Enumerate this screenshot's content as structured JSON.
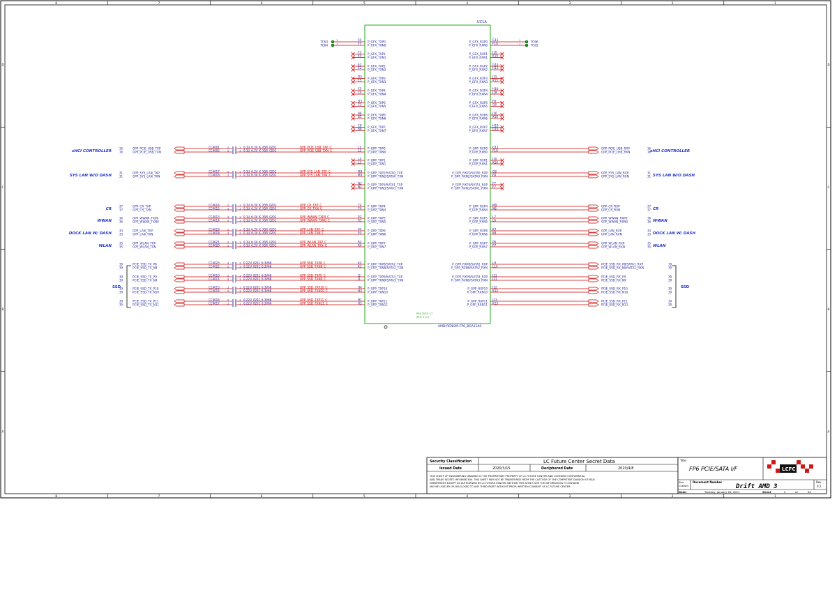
{
  "chip": {
    "ref": "UC1A",
    "part": "AMD-RENOIR-FP6_BGA1140",
    "stamp1": "PRE-TEST: 12",
    "stamp2": "REV: 1.1.0"
  },
  "test_points": {
    "left": [
      {
        "name": "TC63",
        "pin": "1"
      },
      {
        "name": "TC64",
        "pin": "1"
      }
    ],
    "right": [
      {
        "name": "TC66",
        "pin": "1"
      },
      {
        "name": "TC65",
        "pin": "1"
      }
    ]
  },
  "gfx_tx": [
    {
      "pins": [
        "F6",
        "F7"
      ],
      "nets": [
        "P_GFX_TXP0",
        "P_GFX_TXN0"
      ]
    },
    {
      "pins": [
        "F3",
        "E4"
      ],
      "nets": [
        "P_GFX_TXP1",
        "P_GFX_TXN1"
      ]
    },
    {
      "pins": [
        "E1",
        "E2"
      ],
      "nets": [
        "P_GFX_TXP2",
        "P_GFX_TXN2"
      ]
    },
    {
      "pins": [
        "D5",
        "E5"
      ],
      "nets": [
        "P_GFX_TXP3",
        "P_GFX_TXN3"
      ]
    },
    {
      "pins": [
        "C5",
        "C4"
      ],
      "nets": [
        "P_GFX_TXP4",
        "P_GFX_TXN4"
      ]
    },
    {
      "pins": [
        "D3",
        "C3"
      ],
      "nets": [
        "P_GFX_TXP5",
        "P_GFX_TXN5"
      ]
    },
    {
      "pins": [
        "B6",
        "B5"
      ],
      "nets": [
        "P_GFX_TXP6",
        "P_GFX_TXN6"
      ]
    },
    {
      "pins": [
        "C8",
        "B8"
      ],
      "nets": [
        "P_GFX_TXP7",
        "P_GFX_TXN7"
      ]
    }
  ],
  "gfx_rx": [
    {
      "pins": [
        "G11",
        "F10"
      ],
      "nets": [
        "P_GFX_RXP0",
        "P_GFX_RXN0"
      ]
    },
    {
      "pins": [
        "J10",
        "K10"
      ],
      "nets": [
        "P_GFX_RXP1",
        "P_GFX_RXN1"
      ]
    },
    {
      "pins": [
        "G13",
        "H13"
      ],
      "nets": [
        "P_GFX_RXP2",
        "P_GFX_RXN2"
      ]
    },
    {
      "pins": [
        "J15",
        "K15"
      ],
      "nets": [
        "P_GFX_RXP3",
        "P_GFX_RXN3"
      ]
    },
    {
      "pins": [
        "H18",
        "J18"
      ],
      "nets": [
        "P_GFX_RXP4",
        "P_GFX_RXN4"
      ]
    },
    {
      "pins": [
        "F8",
        "G8"
      ],
      "nets": [
        "P_GFX_RXP5",
        "P_GFX_RXN5"
      ]
    },
    {
      "pins": [
        "J16",
        "K16"
      ],
      "nets": [
        "P_GFX_RXP6",
        "P_GFX_RXN6"
      ]
    },
    {
      "pins": [
        "H19",
        "G19"
      ],
      "nets": [
        "P_GFX_RXP7",
        "P_GFX_RXN7"
      ]
    }
  ],
  "gpp_left": [
    {
      "label": "xHCI CONTROLLER",
      "sheet": "16",
      "caps": [
        "CC4001",
        "CC4002"
      ],
      "capval": "0.1U_6.3V_K_X5R_0201",
      "ext": [
        "GPP_PCIE_USB_TXP",
        "GPP_PCIE_USB_TXN"
      ],
      "mid": [
        "GPP_PCIE_USB_TXP_C",
        "GPP_PCIE_USB_TXN_C"
      ],
      "pins": [
        "L1",
        "L2"
      ],
      "chip": [
        "P_GPP_TXP0",
        "P_GPP_TXN0"
      ]
    },
    {
      "label": "",
      "sheet": "",
      "caps": [],
      "capval": "",
      "ext": [],
      "mid": [],
      "pins": [
        "L4",
        "L3"
      ],
      "chip": [
        "P_GPP_TXP1",
        "P_GPP_TXN1"
      ]
    },
    {
      "label": "SYS LAN W/O DASH",
      "sheet": "31",
      "caps": [
        "CC4017",
        "CC4018"
      ],
      "capval": "0.1U_6.3V_K_X5R_0201",
      "ext": [
        "GPP_SYS_LAN_TXP",
        "GPP_SYS_LAN_TXN"
      ],
      "mid": [
        "GPP_SYS_LAN_TXP_C",
        "GPP_SYS_LAN_TXN_C"
      ],
      "pins": [
        "M4",
        "M3"
      ],
      "chip": [
        "P_GPP_TXP2/SATA0_TXP",
        "P_GPP_TXN2/SATA0_TXN"
      ]
    },
    {
      "label": "",
      "sheet": "",
      "caps": [],
      "capval": "",
      "ext": [],
      "mid": [],
      "pins": [
        "N2",
        "N1"
      ],
      "chip": [
        "P_GPP_TXP3/SATA1_TXP",
        "P_GPP_TXN3/SATA1_TXN"
      ]
    },
    {
      "label": "CR",
      "sheet": "37",
      "caps": [
        "CC4014",
        "CC4015"
      ],
      "capval": "0.1U_6.3V_K_X5R_0201",
      "ext": [
        "GPP_CR_TXP",
        "GPP_CR_TXN"
      ],
      "mid": [
        "GPP_CR_TXP_C",
        "GPP_CR_TXN_C"
      ],
      "pins": [
        "T2",
        "T4"
      ],
      "chip": [
        "P_GPP_TXP4",
        "P_GPP_TXN4"
      ]
    },
    {
      "label": "WWAN",
      "sheet": "36",
      "caps": [
        "CC4013",
        "CC4014"
      ],
      "capval": "0.1U_6.3V_K_X5R_0201",
      "ext": [
        "GPP_WWAN_TXP0",
        "GPP_WWAN_TXN0"
      ],
      "mid": [
        "GPP_WWAN_TXP0_C",
        "GPP_WWAN_TXN0_C"
      ],
      "pins": [
        "P2",
        "R1"
      ],
      "chip": [
        "P_GPP_TXP5",
        "P_GPP_TXN5"
      ]
    },
    {
      "label": "DOCK LAN W/ DASH",
      "sheet": "33",
      "caps": [
        "CC4019",
        "CC4018"
      ],
      "capval": "0.1U_6.3V_K_X5R_0201",
      "ext": [
        "GPP_LAN_TXP",
        "GPP_LAN_TXN"
      ],
      "mid": [
        "GPP_LAN_TXP_C",
        "GPP_LAN_TXN_C"
      ],
      "pins": [
        "P4",
        "P3"
      ],
      "chip": [
        "P_GPP_TXP6",
        "P_GPP_TXN6"
      ]
    },
    {
      "label": "WLAN",
      "sheet": "35",
      "caps": [
        "CC4021",
        "CC4020"
      ],
      "capval": "0.1U_6.3V_K_X5R_0201",
      "ext": [
        "GPP_WLAN_TXP",
        "GPP_WLAN_TXN"
      ],
      "mid": [
        "GPP_WLAN_TXP_C",
        "GPP_WLAN_TXN_C"
      ],
      "pins": [
        "R2",
        "R4"
      ],
      "chip": [
        "P_GPP_TXP7",
        "P_GPP_TXN7"
      ]
    },
    {
      "label": "SSD",
      "sheet": "39",
      "caps": [
        "CC4023",
        "CC4022"
      ],
      "capval": "0.22U_0201_6.3V6K",
      "ext": [
        "PCIE_SSD_TX_P8",
        "PCIE_SSD_TX_N8"
      ],
      "mid": [
        "GPP_SSD_TXP8_C",
        "GPP_SSD_TXN8_C"
      ],
      "pins": [
        "K2",
        "K1"
      ],
      "chip": [
        "P_GPP_TXP8/SATA2_TXP",
        "P_GPP_TXN8/SATA2_TXN"
      ]
    },
    {
      "label": "",
      "sheet": "39",
      "caps": [
        "CC4010",
        "CC4011"
      ],
      "capval": "0.22U_0201_6.3V6K",
      "ext": [
        "PCIE_SSD_TX_P9",
        "PCIE_SSD_TX_N9"
      ],
      "mid": [
        "GPP_SSD_TXP9_C",
        "GPP_SSD_TXN9_C"
      ],
      "pins": [
        "J2",
        "J1"
      ],
      "chip": [
        "P_GPP_TXP9/SATA3_TXP",
        "P_GPP_TXN9/SATA3_TXN"
      ]
    },
    {
      "label": "",
      "sheet": "39",
      "caps": [
        "CC4015",
        "CC4014"
      ],
      "capval": "0.22U_0201_6.3V6K",
      "ext": [
        "PCIE_SSD_TX_P10",
        "PCIE_SSD_TX_N10"
      ],
      "mid": [
        "GPP_SSD_TXP10_C",
        "GPP_SSD_TXN10_C"
      ],
      "pins": [
        "H4",
        "H3"
      ],
      "chip": [
        "P_GPP_TXP10",
        "P_GPP_TXN10"
      ]
    },
    {
      "label": "",
      "sheet": "39",
      "caps": [
        "CC4016",
        "CC4017"
      ],
      "capval": "0.22U_0201_6.3V6K",
      "ext": [
        "PCIE_SSD_TX_P11",
        "PCIE_SSD_TX_N11"
      ],
      "mid": [
        "GPP_SSD_TXP11_C",
        "GPP_SSD_TXN11_C"
      ],
      "pins": [
        "H1",
        "H2"
      ],
      "chip": [
        "P_GPP_TXP11",
        "P_GPP_TXN11"
      ]
    }
  ],
  "gpp_right": [
    {
      "label": "xHCI CONTROLLER",
      "sheet": "16",
      "ext": [
        "GPP_PCIE_USB_RXP",
        "GPP_PCIE_USB_RXN"
      ],
      "pins": [
        "G11",
        "F10"
      ],
      "chip": [
        "P_GPP_RXP0",
        "P_GPP_RXN0"
      ]
    },
    {
      "label": "",
      "sheet": "",
      "ext": [],
      "pins": [
        "J10",
        "K10"
      ],
      "chip": [
        "P_GPP_RXP1",
        "P_GPP_RXN1"
      ]
    },
    {
      "label": "SYS LAN W/O DASH",
      "sheet": "31",
      "ext": [
        "GPP_SYS_LAN_RXP",
        "GPP_SYS_LAN_RXN"
      ],
      "pins": [
        "G8",
        "F8"
      ],
      "chip": [
        "P_GPP_RXP2/SATA0_RXP",
        "P_GPP_RXN2/SATA0_RXN"
      ]
    },
    {
      "label": "",
      "sheet": "",
      "ext": [],
      "pins": [
        "F7",
        "F7"
      ],
      "chip": [
        "P_GPP_RXP3/SATA1_RXP",
        "P_GPP_RXN3/SATA1_RXN"
      ]
    },
    {
      "label": "CR",
      "sheet": "37",
      "ext": [
        "GPP_CR_RXP",
        "GPP_CR_RXN"
      ],
      "pins": [
        "M9",
        "N8"
      ],
      "chip": [
        "P_GPP_RXP4",
        "P_GPP_RXN4"
      ]
    },
    {
      "label": "WWAN",
      "sheet": "36",
      "ext": [
        "GPP_WWAN_RXP0",
        "GPP_WWAN_RXN0"
      ],
      "pins": [
        "L7",
        "L6"
      ],
      "chip": [
        "P_GPP_RXP5",
        "P_GPP_RXN5"
      ]
    },
    {
      "label": "DOCK LAN W/ DASH",
      "sheet": "33",
      "ext": [
        "GPP_LAN_RXP",
        "GPP_LAN_RXN"
      ],
      "pins": [
        "K7",
        "K8"
      ],
      "chip": [
        "P_GPP_RXP6",
        "P_GPP_RXN6"
      ]
    },
    {
      "label": "WLAN",
      "sheet": "35",
      "ext": [
        "GPP_WLAN_RXP",
        "GPP_WLAN_RXN"
      ],
      "pins": [
        "P6",
        "P7"
      ],
      "chip": [
        "P_GPP_RXP7",
        "P_GPP_RXN7"
      ]
    },
    {
      "label": "SSD",
      "sheet": "39",
      "ext": [
        "PCIE_SSD_RX_P8/SATA1_RXP",
        "PCIE_SSD_RX_N8/SATA1_RXN"
      ],
      "pins": [
        "L9",
        "L10"
      ],
      "chip": [
        "P_GPP_RXP8/SATA2_RXP",
        "P_GPP_RXN8/SATA2_RXN"
      ]
    },
    {
      "label": "",
      "sheet": "39",
      "ext": [
        "PCIE_SSD_RX_P9",
        "PCIE_SSD_RX_N9"
      ],
      "pins": [
        "J11",
        "J11"
      ],
      "chip": [
        "P_GPP_RXP9/SATA3_RXP",
        "P_GPP_RXN9/SATA3_RXN"
      ]
    },
    {
      "label": "",
      "sheet": "39",
      "ext": [
        "PCIE_SSD_RX_P10",
        "PCIE_SSD_RX_N10"
      ],
      "pins": [
        "J12",
        "K12"
      ],
      "chip": [
        "P_GPP_RXP10",
        "P_GPP_RXN10"
      ]
    },
    {
      "label": "",
      "sheet": "39",
      "ext": [
        "PCIE_SSD_RX_P11",
        "PCIE_SSD_RX_N11"
      ],
      "pins": [
        "J13",
        "K13"
      ],
      "chip": [
        "P_GPP_RXP11",
        "P_GPP_RXN11"
      ]
    }
  ],
  "title_block": {
    "security_label": "Security Classification",
    "security_value": "LC Future Center Secret Data",
    "issued_label": "Issued Date",
    "issued_value": "2020/3/15",
    "deciphered_label": "Deciphered Date",
    "deciphered_value": "2020/4/8",
    "notice_1": "THIS SHEET OF ENGINEERING DRAWING IS THE PROPRIETARY PROPERTY OF LC FUTURE CENTER AND CONTAINS CONFIDENTIAL",
    "notice_2": "AND TRADE SECRET INFORMATION. THIS SHEET MAY NOT BE TRANSFERED FROM THE CUSTODY OF THE COMPETENT DIVISION OF R&D",
    "notice_3": "DEPARTMENT EXCEPT AS AUTHORIZED BY LC FUTURE CENTER. NEITHER THIS SHEET NOR THE INFORMATION IT CONTAINS",
    "notice_4": "MAY BE USED BY OR DISCLOSED TO ANY THIRD PARTY WITHOUT PRIOR WRITTEN CONSENT OF LC FUTURE CENTER.",
    "title_label": "Title",
    "title_value": "FP6 PCIE/SATA I/F",
    "size_label": "Size",
    "size_value": "Custom",
    "doc_label": "Document Number",
    "doc_value": "Drift AMD 3",
    "rev_label": "Rev",
    "rev_value": "0.2",
    "date_label": "Date:",
    "date_value": "Tuesday, January 26, 2021",
    "sheet_label": "Sheet",
    "sheet_num": "2",
    "of_label": "of",
    "sheet_total": "64",
    "logo_text": "LCFC"
  },
  "border_marks": {
    "columns": [
      "8",
      "7",
      "6",
      "5",
      "4",
      "3",
      "2",
      "1"
    ],
    "rows": [
      "D",
      "C",
      "B",
      "A"
    ]
  },
  "colors": {
    "chip_outline": "#22aa22",
    "net_blue": "#1a1a99",
    "net_red": "#cc0000",
    "label_blue": "#2233cc",
    "logo_red": "#d01818"
  }
}
